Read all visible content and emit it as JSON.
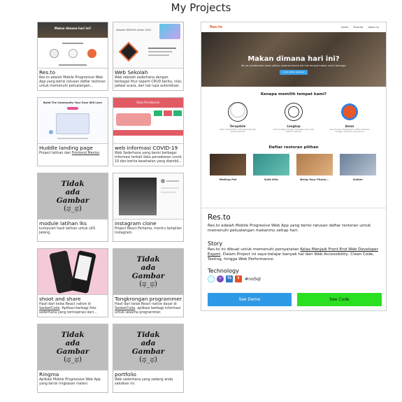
{
  "page_title": "My Projects",
  "projects": [
    {
      "title": "Res.to",
      "desc": "Res.to adalah Mobile Progressive Web App yang berisi ratusan daftar restoran untuk memenuhi petualangan..."
    },
    {
      "title": "Web Sekolah",
      "desc": "Web sekolah sederhana dengan berbagai fitur seperti CRUD berita, nilai, jadwal acara, dan tak lupa autentikasi."
    },
    {
      "title": "Huddle landing page",
      "desc_prefix": "Project latihan dari ",
      "desc_link": "Frontend Mentor"
    },
    {
      "title": "web informasi COVID-19",
      "desc": "Web Sederhana yang berisi berbagai informasi terkait data persebaran covid-19 dan berita kesehatan yang diambil..."
    },
    {
      "title": "module latihan lks",
      "desc": "kumpulah hasil latihan untuk LKS Jateng."
    },
    {
      "title": "instagram clone",
      "desc": "Project React Pertama, meniru tampilan instagram."
    },
    {
      "title": "shoot and share",
      "desc_prefix": "Hasil dari kelas React native di ",
      "desc_link": "SanberCode",
      "desc_suffix": ". Aplikasi berbagi foto sederhana yang terinspirasi dari..."
    },
    {
      "title": "Tongkrongan programmer",
      "desc_prefix": "Hasil dari kelas React native dasar di ",
      "desc_link": "SanberCode",
      "desc_suffix": ". aplikasi berbagi informasi untuk sesama programmer."
    },
    {
      "title": "Ringma",
      "desc": "Aplikasi Mobile Progressive Web App yang berisi ringkasan materi."
    },
    {
      "title": "portfolio",
      "desc": "Web sederhana yang sedang anda saksikan ini."
    }
  ],
  "placeholder": {
    "line1": "Tidak",
    "line2": "ada",
    "line3": "Gambar",
    "face": "(ಥ_ಥ)"
  },
  "thumbs": {
    "resto_hero": "Makan dimana hari ini?",
    "sekolah_heading": "sekolah DIROAH anime 2022",
    "huddle_heading": "Build The Community Your Fans Will Love",
    "covid_heading": "Data Persebaran"
  },
  "detail": {
    "preview": {
      "logo": "Res.to",
      "nav": [
        "Home",
        "Favorite",
        "About us"
      ],
      "hero_title": "Makan dimana hari ini?",
      "hero_sub": "Res.to memberikan kamu pilihan restoran favorit dan ide tempat makan untuk keluarga.",
      "hero_button": "Lihat daftar restoran",
      "why_title": "Kenapa memilih tempat kami?",
      "features": [
        {
          "name": "Terupdate",
          "text": "Kami memberikan informasi tiap hari secara berkala"
        },
        {
          "name": "Lengkap",
          "text": "Kami lengkap dengan berbagai menu dan pilihan restoran"
        },
        {
          "name": "Aman",
          "text": "Kami hanya memberikan daftar restoran dengan makanan yang aman"
        }
      ],
      "list_title": "Daftar restoran pilihan",
      "restaurants": [
        "Melting Pot",
        "Kafe Kita",
        "Bring Your Phone...",
        "Kafein"
      ]
    },
    "name": "Res.to",
    "description": "Res.to adalah Mobile Progresive Web App yang berisi ratusan daftar restoran untuk memenuhi petualangan makanmu setiap hari.",
    "story_heading": "Story",
    "story_prefix": "Res.to ini dibuat untuk memenuhi persyaratan ",
    "story_link": "Kelas Menjadi Front-End Web Developer Expert",
    "story_suffix": ". Dalam Project ini saya belajar banyak hal dari Web Accessibility, Clean Code, Testing, hingga Web Performance.",
    "tech_heading": "Technology",
    "tech_text": "#noSql",
    "tech_icons": [
      "react-icon",
      "redux-icon",
      "typescript-icon",
      "html5-icon"
    ],
    "tech_labels": {
      "ts": "TS",
      "html": "5"
    },
    "buttons": {
      "demo": "See Demo",
      "code": "See Code"
    },
    "colors": {
      "demo": "#2e99e6",
      "code": "#2ae020"
    }
  }
}
